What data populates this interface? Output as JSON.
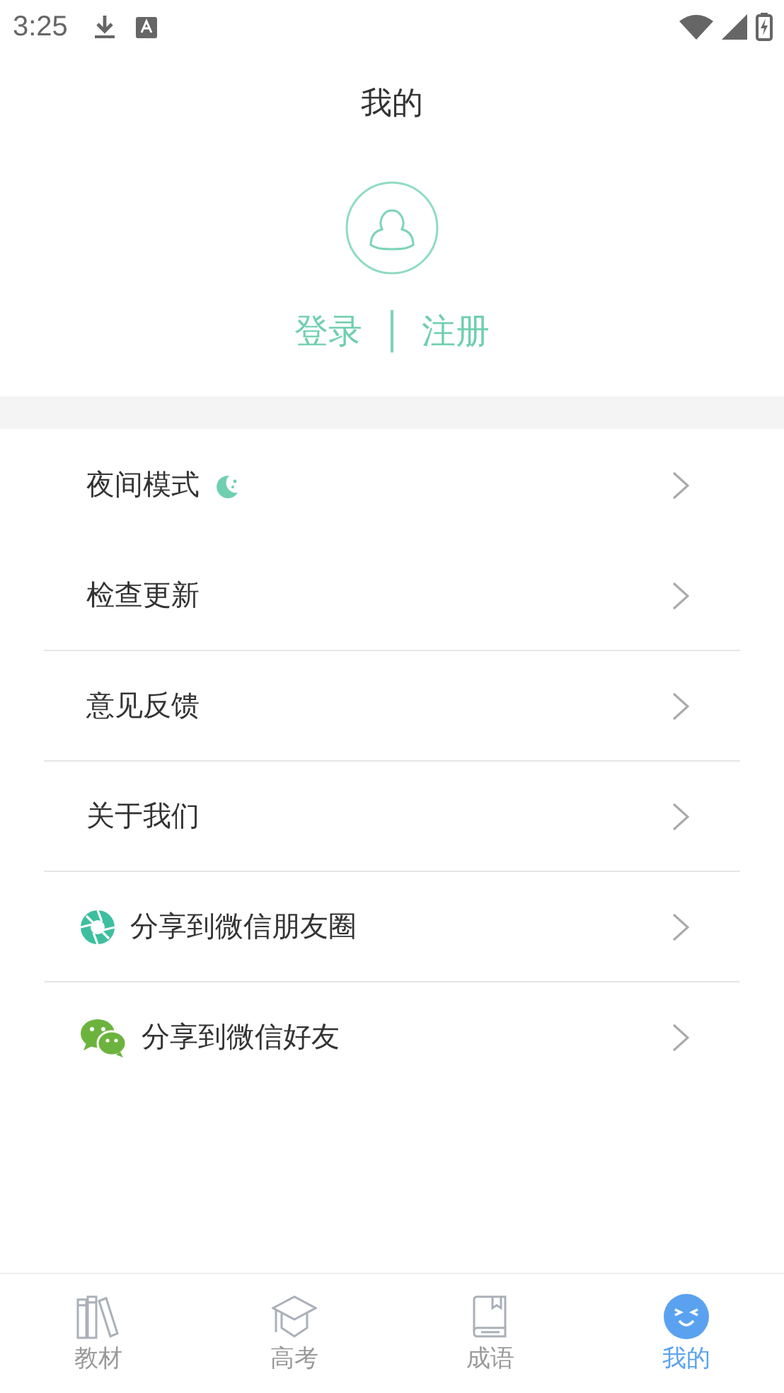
{
  "status_bar": {
    "time": "3:25"
  },
  "title": "我的",
  "account": {
    "login": "登录",
    "register": "注册"
  },
  "menu": [
    {
      "label": "夜间模式",
      "kind": "night"
    },
    {
      "label": "检查更新",
      "kind": "plain"
    },
    {
      "label": "意见反馈",
      "kind": "plain"
    },
    {
      "label": "关于我们",
      "kind": "plain"
    },
    {
      "label": "分享到微信朋友圈",
      "kind": "moments"
    },
    {
      "label": "分享到微信好友",
      "kind": "wechat"
    }
  ],
  "tabs": [
    {
      "label": "教材",
      "kind": "books",
      "selected": false
    },
    {
      "label": "高考",
      "kind": "cap",
      "selected": false
    },
    {
      "label": "成语",
      "kind": "book",
      "selected": false
    },
    {
      "label": "我的",
      "kind": "face",
      "selected": true
    }
  ]
}
